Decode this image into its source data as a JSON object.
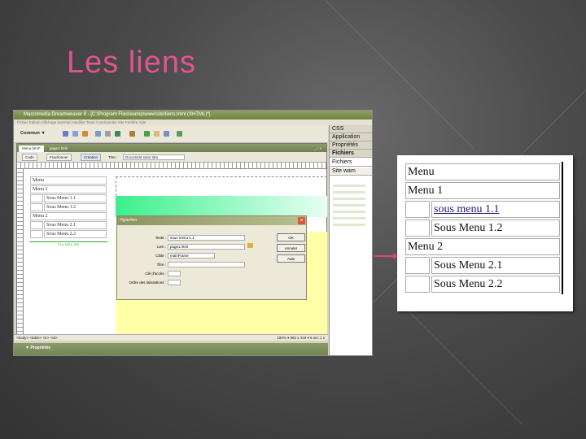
{
  "slide": {
    "title": "Les liens",
    "accent": "#e0558f"
  },
  "dreamweaver": {
    "window_title": "Macromedia Dreamweaver 8 - [C:\\Program Files\\wamp\\www\\site\\liens.html (XHTML)*]",
    "menu": "Fichier  Edition  Affichage  Insertion  Modifier  Texte  Commandes  Site  Fenêtre  Aide",
    "insert_category": "Commun",
    "panels": [
      "CSS",
      "Application",
      "Propriétés",
      "Fichiers"
    ],
    "files_tab": "Fichiers",
    "site_label": "Site wam",
    "tabs": [
      "Menu.html*",
      "page1.html"
    ],
    "view_buttons": [
      "Code",
      "Fractionner",
      "Création"
    ],
    "title_label": "Titre :",
    "title_value": "Document sans titre",
    "menu_table": [
      {
        "indent": false,
        "text": "Menu"
      },
      {
        "indent": false,
        "text": "Menu 1"
      },
      {
        "indent": true,
        "text": "Sous Menu 1.1"
      },
      {
        "indent": true,
        "text": "Sous Menu 1.2"
      },
      {
        "indent": false,
        "text": "Menu 2"
      },
      {
        "indent": true,
        "text": "Sous Menu 2.1"
      },
      {
        "indent": true,
        "text": "Sous Menu 2.2"
      }
    ],
    "table_widths": "21 ▸ 182 ▸ 200",
    "status_path": "<body> <table> <tr> <td>",
    "status_right": "100%  ▾  892 x 419 ▾  5 sec 1 s",
    "properties_label": "▼ Propriétés",
    "dialog": {
      "title": "Hyperlien",
      "fields": [
        {
          "label": "Texte :",
          "value": "sous menu 1.1"
        },
        {
          "label": "Lien :",
          "value": "page1.html"
        },
        {
          "label": "Cible :",
          "value": "mainFrame"
        },
        {
          "label": "Titre :",
          "value": ""
        },
        {
          "label": "Clé d'accès :",
          "value": ""
        },
        {
          "label": "Ordre des tabulations :",
          "value": ""
        }
      ],
      "buttons": [
        "OK",
        "Annuler",
        "Aide"
      ]
    }
  },
  "result": {
    "rows": [
      {
        "indent": false,
        "text": "Menu",
        "link": false
      },
      {
        "indent": false,
        "text": "Menu 1",
        "link": false
      },
      {
        "indent": true,
        "text": "sous menu 1.1",
        "link": true
      },
      {
        "indent": true,
        "text": "Sous Menu 1.2",
        "link": false
      },
      {
        "indent": false,
        "text": "Menu 2",
        "link": false
      },
      {
        "indent": true,
        "text": "Sous Menu 2.1",
        "link": false
      },
      {
        "indent": true,
        "text": "Sous Menu 2.2",
        "link": false
      }
    ],
    "link_color": "#1a1a7a"
  },
  "arrow_color": "#e0408a"
}
